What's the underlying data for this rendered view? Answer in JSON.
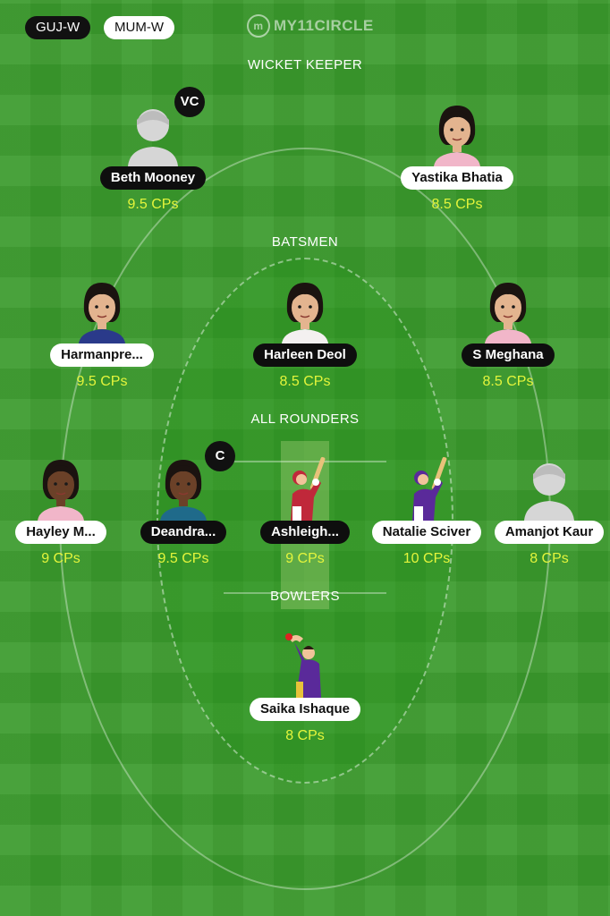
{
  "teams": {
    "team_a": "GUJ-W",
    "team_b": "MUM-W"
  },
  "logo": {
    "mark": "m",
    "text": "MY11CIRCLE"
  },
  "sections": {
    "wicket_keeper": "WICKET KEEPER",
    "batsmen": "BATSMEN",
    "all_rounders": "ALL ROUNDERS",
    "bowlers": "BOWLERS"
  },
  "badges": {
    "vice_captain": "VC",
    "captain": "C"
  },
  "players": {
    "wk": [
      {
        "name": "Beth Mooney",
        "credits": "9.5 CPs",
        "team": "GUJ-W",
        "avatar": "placeholder-silhouette"
      },
      {
        "name": "Yastika Bhatia",
        "credits": "8.5 CPs",
        "team": "MUM-W",
        "avatar": "player-photo"
      }
    ],
    "bat": [
      {
        "name": "Harmanpre...",
        "credits": "9.5 CPs",
        "team": "MUM-W",
        "avatar": "player-photo"
      },
      {
        "name": "Harleen Deol",
        "credits": "8.5 CPs",
        "team": "GUJ-W",
        "avatar": "player-photo"
      },
      {
        "name": "S Meghana",
        "credits": "8.5 CPs",
        "team": "GUJ-W",
        "avatar": "player-photo"
      }
    ],
    "ar": [
      {
        "name": "Hayley M...",
        "credits": "9 CPs",
        "team": "MUM-W",
        "avatar": "player-photo"
      },
      {
        "name": "Deandra...",
        "credits": "9.5 CPs",
        "team": "GUJ-W",
        "avatar": "player-photo"
      },
      {
        "name": "Ashleigh...",
        "credits": "9 CPs",
        "team": "GUJ-W",
        "avatar": "batter-illustration"
      },
      {
        "name": "Natalie Sciver",
        "credits": "10 CPs",
        "team": "MUM-W",
        "avatar": "batter-illustration"
      },
      {
        "name": "Amanjot Kaur",
        "credits": "8 CPs",
        "team": "MUM-W",
        "avatar": "placeholder-silhouette"
      }
    ],
    "bowl": [
      {
        "name": "Saika Ishaque",
        "credits": "8 CPs",
        "team": "MUM-W",
        "avatar": "bowler-illustration"
      }
    ]
  },
  "colors": {
    "field": "#3a9a2c",
    "credits": "#e4f53c",
    "team_a_chip": "#111111",
    "team_b_chip": "#ffffff"
  }
}
